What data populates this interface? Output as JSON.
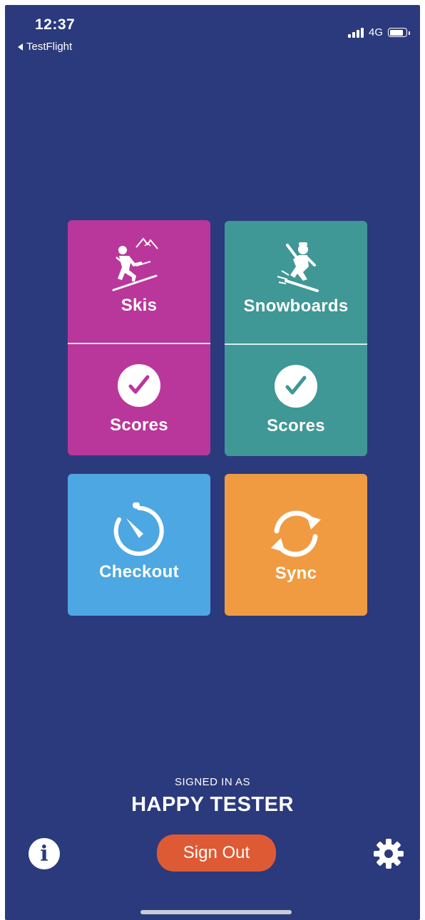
{
  "status_bar": {
    "time": "12:37",
    "back_app": "TestFlight",
    "network": "4G",
    "battery_level": 0.85
  },
  "tiles": {
    "skis": {
      "label": "Skis",
      "scores_label": "Scores",
      "color": "#b9379a"
    },
    "snowboards": {
      "label": "Snowboards",
      "scores_label": "Scores",
      "color": "#3f9796"
    },
    "checkout": {
      "label": "Checkout",
      "color": "#4da7e2"
    },
    "sync": {
      "label": "Sync",
      "color": "#f09b41"
    }
  },
  "account": {
    "signed_in_label": "SIGNED IN AS",
    "user_name": "HAPPY TESTER",
    "sign_out_label": "Sign Out",
    "sign_out_color": "#de5a35"
  },
  "colors": {
    "background": "#2b3a7d"
  },
  "icons": {
    "info": "info-icon",
    "settings": "gear-icon",
    "skier": "skier-icon",
    "snowboarder": "snowboarder-icon",
    "check": "check-icon",
    "stopwatch": "stopwatch-icon",
    "sync": "sync-icon"
  }
}
